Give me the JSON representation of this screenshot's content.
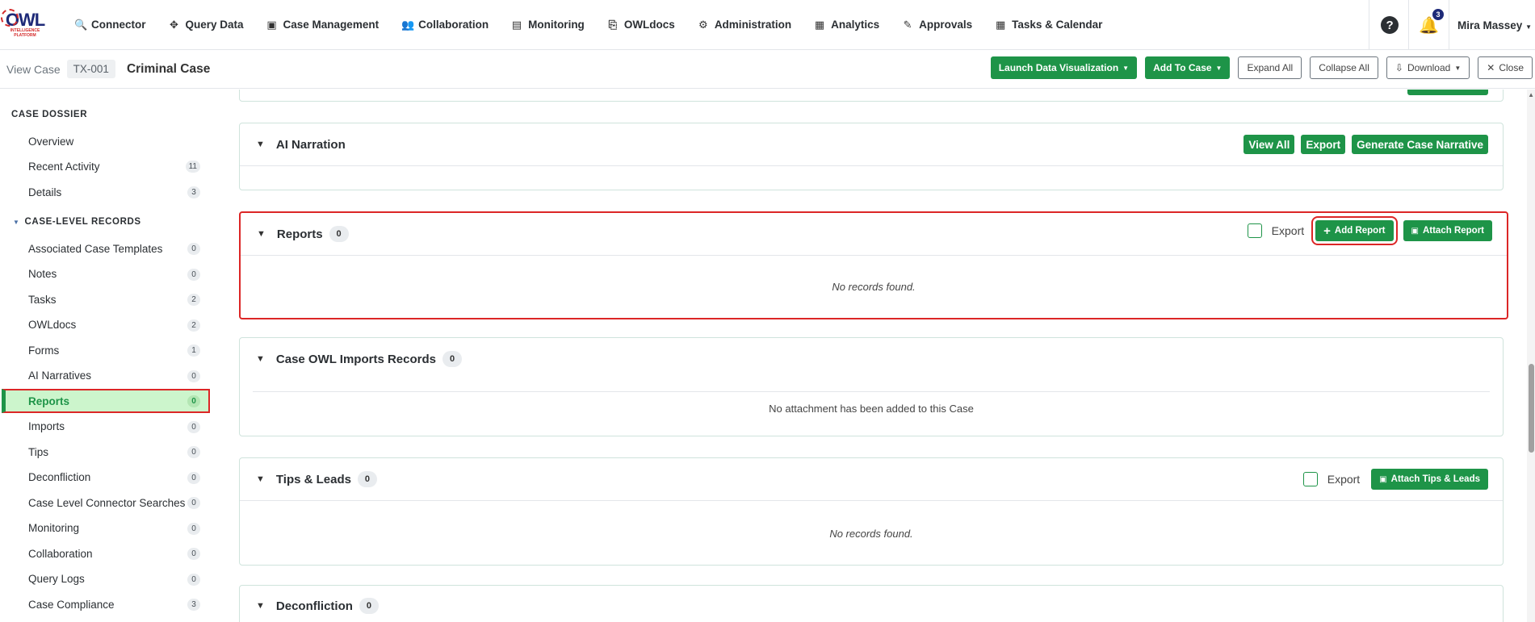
{
  "nav": {
    "logo_text": "OWL",
    "logo_sub": "INTELLIGENCE PLATFORM",
    "items": [
      {
        "label": "Connector",
        "icon": "search-icon",
        "glyph": "🔍"
      },
      {
        "label": "Query Data",
        "icon": "move-arrows-icon",
        "glyph": "✥"
      },
      {
        "label": "Case Management",
        "icon": "contact-card-icon",
        "glyph": "▣"
      },
      {
        "label": "Collaboration",
        "icon": "users-icon",
        "glyph": "👥"
      },
      {
        "label": "Monitoring",
        "icon": "monitor-chart-icon",
        "glyph": "▤"
      },
      {
        "label": "OWLdocs",
        "icon": "document-arrow-icon",
        "glyph": "⎘"
      },
      {
        "label": "Administration",
        "icon": "user-gear-icon",
        "glyph": "⚙"
      },
      {
        "label": "Analytics",
        "icon": "file-chart-icon",
        "glyph": "▦"
      },
      {
        "label": "Approvals",
        "icon": "stamp-icon",
        "glyph": "✎"
      },
      {
        "label": "Tasks & Calendar",
        "icon": "calendar-icon",
        "glyph": "▦"
      }
    ],
    "help_glyph": "?",
    "notification_count": "3",
    "user_name": "Mira Massey"
  },
  "subheader": {
    "view_label": "View Case",
    "case_id": "TX-001",
    "case_title": "Criminal Case",
    "buttons": {
      "launch": "Launch Data Visualization",
      "add_to_case": "Add To Case",
      "expand_all": "Expand All",
      "collapse_all": "Collapse All",
      "download": "Download",
      "close": "Close"
    }
  },
  "sidebar": {
    "dossier_heading": "CASE DOSSIER",
    "dossier_items": [
      {
        "label": "Overview",
        "count": ""
      },
      {
        "label": "Recent Activity",
        "count": "11"
      },
      {
        "label": "Details",
        "count": "3"
      }
    ],
    "records_heading": "CASE-LEVEL RECORDS",
    "records_items": [
      {
        "label": "Associated Case Templates",
        "count": "0"
      },
      {
        "label": "Notes",
        "count": "0"
      },
      {
        "label": "Tasks",
        "count": "2"
      },
      {
        "label": "OWLdocs",
        "count": "2"
      },
      {
        "label": "Forms",
        "count": "1"
      },
      {
        "label": "AI Narratives",
        "count": "0"
      },
      {
        "label": "Reports",
        "count": "0",
        "active": true
      },
      {
        "label": "Imports",
        "count": "0"
      },
      {
        "label": "Tips",
        "count": "0"
      },
      {
        "label": "Deconfliction",
        "count": "0"
      },
      {
        "label": "Case Level Connector Searches",
        "count": "0"
      },
      {
        "label": "Monitoring",
        "count": "0"
      },
      {
        "label": "Collaboration",
        "count": "0"
      },
      {
        "label": "Query Logs",
        "count": "0"
      },
      {
        "label": "Case Compliance",
        "count": "3"
      }
    ]
  },
  "panels": {
    "ai_narration": {
      "title": "AI Narration",
      "view_all": "View All",
      "export": "Export",
      "generate": "Generate Case Narrative"
    },
    "reports": {
      "title": "Reports",
      "count": "0",
      "export_label": "Export",
      "add_report": "Add Report",
      "attach_report": "Attach Report",
      "empty": "No records found."
    },
    "imports": {
      "title": "Case OWL Imports Records",
      "count": "0",
      "empty": "No attachment has been added to this Case"
    },
    "tips": {
      "title": "Tips & Leads",
      "count": "0",
      "export_label": "Export",
      "attach": "Attach Tips & Leads",
      "empty": "No records found."
    },
    "deconfliction": {
      "title": "Deconfliction",
      "count": "0"
    }
  },
  "colors": {
    "accent_green": "#1e9448",
    "highlight_red": "#dc2626",
    "active_bg": "#ccf5cc",
    "logo_blue": "#1e2a78"
  }
}
